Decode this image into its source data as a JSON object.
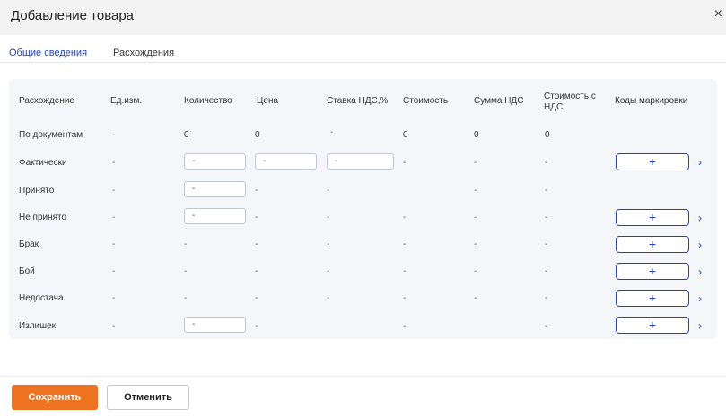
{
  "dialog": {
    "title": "Добавление товара",
    "close_label": "×"
  },
  "tabs": [
    {
      "label": "Общие сведения",
      "active": true
    },
    {
      "label": "Расхождения",
      "active": false
    }
  ],
  "table": {
    "headers": [
      "Расхождение",
      "Ед.изм.",
      "Количество",
      "Цена",
      "Ставка НДС,%",
      "Стоимость",
      "Сумма НДС",
      "Стоимость с НДС",
      "Коды маркировки"
    ],
    "rows": [
      {
        "label": "По документам",
        "unit": "-",
        "qty": "0",
        "price": "0",
        "vat_rate": "-",
        "cost": "0",
        "vat_sum": "0",
        "cost_vat": "0"
      },
      {
        "label": "Фактически",
        "unit": "-",
        "qty_input": "-",
        "price_input": "-",
        "vat_input": "-",
        "cost": "-",
        "vat_sum": "-",
        "cost_vat": "-",
        "plus": "+"
      },
      {
        "label": "Принято",
        "unit": "-",
        "qty_input": "-",
        "price": "-",
        "vat_rate": "-",
        "vat_sum": "-",
        "cost_vat": "-"
      },
      {
        "label": "Не принято",
        "unit": "-",
        "qty_input": "-",
        "price": "-",
        "vat_rate": "-",
        "cost": "-",
        "vat_sum": "-",
        "cost_vat": "-",
        "plus": "+"
      },
      {
        "label": "Брак",
        "unit": "-",
        "qty": "-",
        "price": "-",
        "vat_rate": "-",
        "cost": "-",
        "vat_sum": "-",
        "cost_vat": "-",
        "plus": "+"
      },
      {
        "label": "Бой",
        "unit": "-",
        "qty": "-",
        "price": "-",
        "vat_rate": "-",
        "cost": "-",
        "vat_sum": "-",
        "cost_vat": "-",
        "plus": "+"
      },
      {
        "label": "Недостача",
        "unit": "-",
        "qty": "-",
        "price": "-",
        "vat_rate": "-",
        "cost": "-",
        "vat_sum": "-",
        "cost_vat": "-",
        "plus": "+"
      },
      {
        "label": "Излишек",
        "unit": "-",
        "qty_input": "-",
        "price": "-",
        "cost": "-",
        "cost_vat": "-",
        "plus": "+"
      }
    ],
    "chevron": "›"
  },
  "footer": {
    "save_label": "Сохранить",
    "cancel_label": "Отменить"
  },
  "colors": {
    "accent": "#1e3fd6",
    "save_button": "#ee7320"
  }
}
